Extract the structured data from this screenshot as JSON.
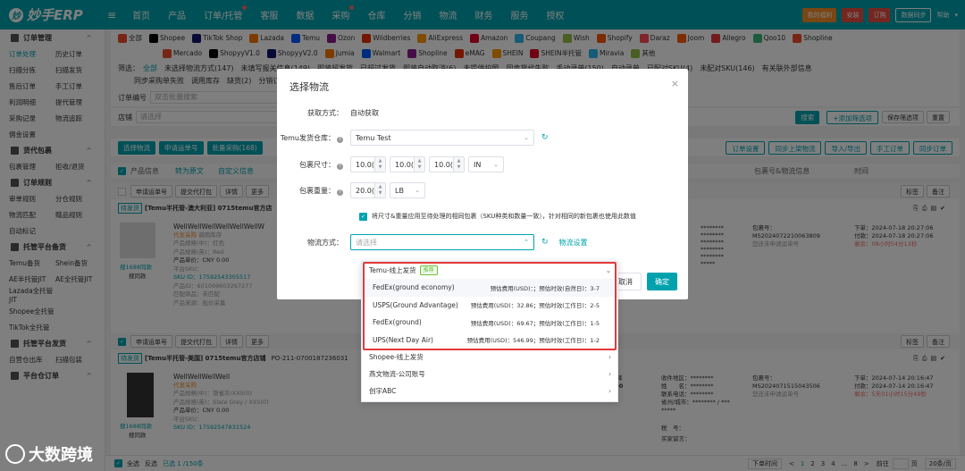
{
  "app": {
    "logo": "妙手ERP",
    "logo_mark": "妙"
  },
  "topnav": {
    "items": [
      "首页",
      "产品",
      "订单/托管",
      "客服",
      "数据",
      "采购",
      "仓库",
      "分销",
      "物流",
      "财务",
      "服务",
      "授权"
    ],
    "dots": [
      2,
      5
    ]
  },
  "topright": {
    "gift": "我的福利",
    "help_btn": "安装",
    "buy": "订购",
    "sync": "数据同步",
    "help": "帮助"
  },
  "sidebar": {
    "groups": [
      {
        "label": "订单管理",
        "rows": [
          [
            "订单处理",
            "历史订单"
          ],
          [
            "扫描分拣",
            "扫描发货"
          ],
          [
            "售后订单",
            "手工订单"
          ],
          [
            "利润明细",
            "提代管理"
          ],
          [
            "采购记录",
            "物流追踪"
          ],
          [
            "佣金设置",
            ""
          ]
        ]
      },
      {
        "label": "货代包裹",
        "rows": [
          [
            "包裹管理",
            "拒收/退货"
          ]
        ]
      },
      {
        "label": "订单规则",
        "rows": [
          [
            "审单规则",
            "分仓规则"
          ],
          [
            "物流匹配",
            "赠品规则"
          ],
          [
            "自动标记",
            ""
          ]
        ]
      },
      {
        "label": "托管平台备货",
        "rows": [
          [
            "Temu备货",
            "Shein备货"
          ],
          [
            "AE半托管JIT",
            "AE全托管JIT"
          ],
          [
            "Lazada全托管JIT",
            ""
          ],
          [
            "Shopee全托管",
            ""
          ],
          [
            "TikTok全托管",
            ""
          ]
        ]
      },
      {
        "label": "托管平台发货",
        "rows": [
          [
            "自营仓出库",
            "扫描包装"
          ]
        ]
      },
      {
        "label": "平台仓订单",
        "rows": []
      }
    ]
  },
  "filters": {
    "platforms_row1": [
      "全部",
      "Shopee",
      "TikTok Shop",
      "Lazada",
      "Temu",
      "Ozon",
      "Wildberries",
      "AliExpress",
      "Amazon",
      "Coupang",
      "Wish",
      "Shopify",
      "Daraz",
      "Joom",
      "Allegro",
      "Qoo10",
      "Shopline"
    ],
    "platforms_row2": [
      "Mercado",
      "ShopyyV1.0",
      "ShopyyV2.0",
      "Jumia",
      "Walmart",
      "Shopline",
      "eMAG",
      "SHEIN",
      "SHEIN半托管",
      "Miravia",
      "其他"
    ],
    "status_label": "筛选：",
    "status_row1": [
      "全部",
      "未选择物流方式(147)",
      "未填写报关信息(149)",
      "即将超发货",
      "已超过发货",
      "即将自动取消(6)",
      "未提供护照",
      "同步货代失败",
      "手动录单(150)",
      "自动录单",
      "已配对SKU(4)",
      "未配对SKU(146)",
      "有关联外部信息"
    ],
    "status_row2": [
      "同步采购单失败",
      "调用库存",
      "缺货(2)",
      "分销订单",
      "+自定义筛选"
    ],
    "order_no_label": "订单编号",
    "order_no_placeholder": "双击批量搜索",
    "store_label": "店铺",
    "store_placeholder": "请选择",
    "search_btn": "搜索",
    "add_filter_btn": "+添加筛选项",
    "save_filter_btn": "保存筛选项",
    "reset_btn": "重置"
  },
  "toolbar": {
    "left": [
      "选择物流",
      "申请运单号",
      "批量采购(168)"
    ],
    "right": [
      "订单设置",
      "同步上架物流",
      "导入/导出",
      "手工订单",
      "同步订单"
    ]
  },
  "table": {
    "header": [
      "产品信息",
      "转为原文",
      "自定义信息",
      "包裹号&物流信息",
      "时间"
    ],
    "row_actions": [
      "申请运单号",
      "提交代打包",
      "详情",
      "更多"
    ],
    "tag_btn": "标签",
    "note_btn": "备注",
    "orders": [
      {
        "status": "待发货",
        "title": "[Temu半托管-澳大利亚] 0715temu官方店",
        "product": "WellWellWellWellWellWellW",
        "source": "代发采购",
        "mapping": "调用库存",
        "spec": "产品规格(中)：红色",
        "spec_en": "产品规格(英)：Red",
        "price": "产品单价：CNY 0.00",
        "platform_sku": "平台SKU：",
        "sku_id": "SKU ID：17592543305517",
        "product_id": "产品ID：601099603267277",
        "match": "匹配商品：未匹配",
        "source_url": "产品来源：批价采集",
        "find_similar": "搜1688同款",
        "search_sim": "搜同款",
        "masked": [
          "********",
          "********",
          "********",
          "********",
          "********",
          "*****"
        ],
        "package_label": "包裹号：",
        "package_no": "MS2024072210063809",
        "package_note": "您还未申请运单号",
        "order_time": "下单：2024-07-18 20:27:06",
        "pay_time": "付款：2024-07-18 20:27:06",
        "remain": "剩余：08小时54分13秒"
      },
      {
        "status": "待发货",
        "title": "[Temu半托管-美国] 0715temu官方店铺",
        "order_no": "PO-211-0700187236031",
        "product": "WellWellWellWell",
        "source": "代发采购",
        "spec": "产品规格(中)：银雀灰/XXS(0)",
        "spec_en": "产品规格(英)：Slate Grey / XXS(0)",
        "price": "产品单价：CNY 0.00",
        "platform_sku": "平台SKU：",
        "sku_id": "SKU ID：17592547831524",
        "find_similar": "搜1688同款",
        "search_sim": "搜同款",
        "ship_label": "买家已选择",
        "ship_amount": "CNY 0.00",
        "recv": [
          "收件地区：********",
          "姓　　名：********",
          "联系电话：********",
          "省州/城市：******** / ***",
          "*****"
        ],
        "tax_label": "税　号：",
        "buyer_note_label": "买家留言：",
        "package_label": "包裹号：",
        "package_no": "MS2024071515043506",
        "package_note": "您还未申请运单号",
        "order_time": "下单：2024-07-14 20:16:47",
        "pay_time": "付款：2024-07-14 20:16:47",
        "remain": "剩余：5天01小时15分49秒"
      }
    ]
  },
  "bottom": {
    "select_all": "全选",
    "invert": "反选",
    "selected": "已选 1 /150条",
    "sort": "下单时间",
    "pages": [
      "<",
      "1",
      "2",
      "3",
      "4",
      "...",
      "8",
      ">"
    ],
    "goto": "前往",
    "page_label": "页",
    "page_size": "20条/页"
  },
  "dialog": {
    "title": "选择物流",
    "close": "×",
    "get_method_label": "获取方式：",
    "get_method_value": "自动获取",
    "warehouse_label": "Temu发货仓库",
    "warehouse_value": "Temu Test",
    "size_label": "包裹尺寸",
    "size_values": [
      "10.0(",
      "10.0(",
      "10.0("
    ],
    "size_unit": "IN",
    "weight_label": "包裹重量",
    "weight_value": "20.0(",
    "weight_unit": "LB",
    "apply_check": "将尺寸&重量应用至待处理的相同包裹（SKU种类和数量一致），针对相同的新包裹也使用此数值",
    "method_label": "物流方式：",
    "method_placeholder": "请选择",
    "method_settings": "物流设置",
    "cancel": "取消",
    "ok": "确定"
  },
  "dropdown": {
    "groups": [
      {
        "label": "Temu-线上发货",
        "tag": "推荐",
        "expanded": true,
        "items": [
          {
            "name": "FedEx(ground economy)",
            "meta": "预估费用(USD)：；预估时效(自然日)：3-7"
          },
          {
            "name": "USPS(Ground Advantage)",
            "meta": "预估费用(USD)：32.86；预估时效(工作日)：2-5"
          },
          {
            "name": "FedEx(ground)",
            "meta": "预估费用(USD)：69.67；预估时效(工作日)：1-5"
          },
          {
            "name": "UPS(Next Day Air)",
            "meta": "预估费用(USD)：546.99；预估时效(工作日)：1-2"
          }
        ]
      },
      {
        "label": "Shopee-线上发货"
      },
      {
        "label": "燕文物流-公司账号"
      },
      {
        "label": "创宇ABC"
      }
    ]
  },
  "watermark": "大数跨境",
  "colors": {
    "brand": "#00a2ae",
    "highlight": "#e4393c",
    "warning": "#f56c6c",
    "success": "#67c23a"
  }
}
